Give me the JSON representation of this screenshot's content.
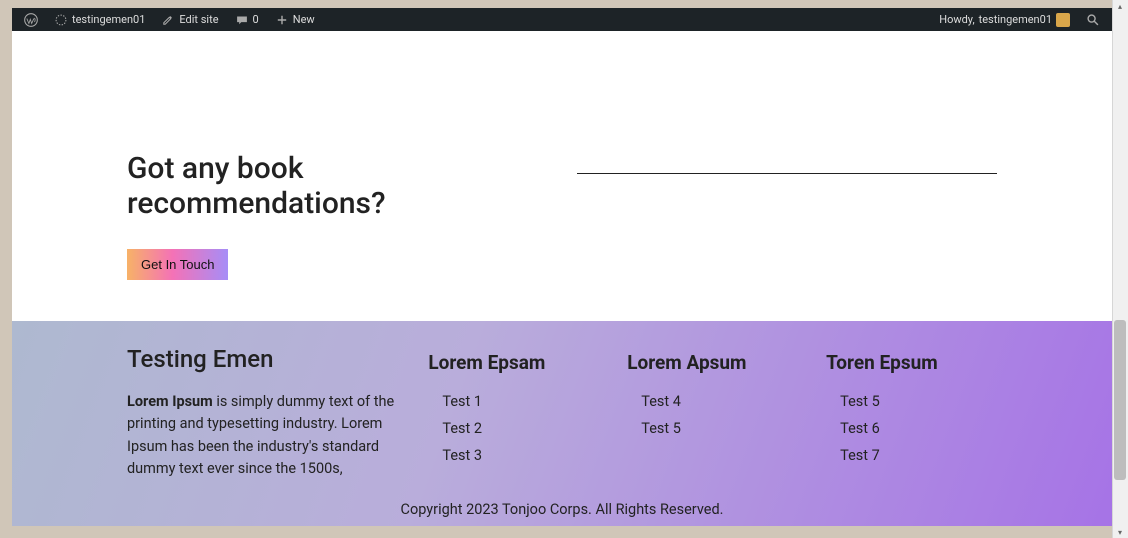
{
  "adminbar": {
    "site_name": "testingemen01",
    "edit_site": "Edit site",
    "comments_count": "0",
    "new_label": "New",
    "howdy_prefix": "Howdy, ",
    "username": "testingemen01"
  },
  "main": {
    "heading": "Got any book recommendations?",
    "button_label": "Get In Touch"
  },
  "footer": {
    "about_title": "Testing Emen",
    "about_bold": "Lorem Ipsum",
    "about_rest": " is simply dummy text of the printing and typesetting industry. Lorem Ipsum has been the industry's standard dummy text ever since the 1500s,",
    "columns": [
      {
        "heading": "Lorem Epsam",
        "items": [
          "Test 1",
          "Test 2",
          "Test 3"
        ]
      },
      {
        "heading": "Lorem Apsum",
        "items": [
          "Test 4",
          "Test 5"
        ]
      },
      {
        "heading": "Toren Epsum",
        "items": [
          "Test 5",
          "Test 6",
          "Test 7"
        ]
      }
    ],
    "copyright": "Copyright 2023 Tonjoo Corps. All Rights Reserved."
  }
}
